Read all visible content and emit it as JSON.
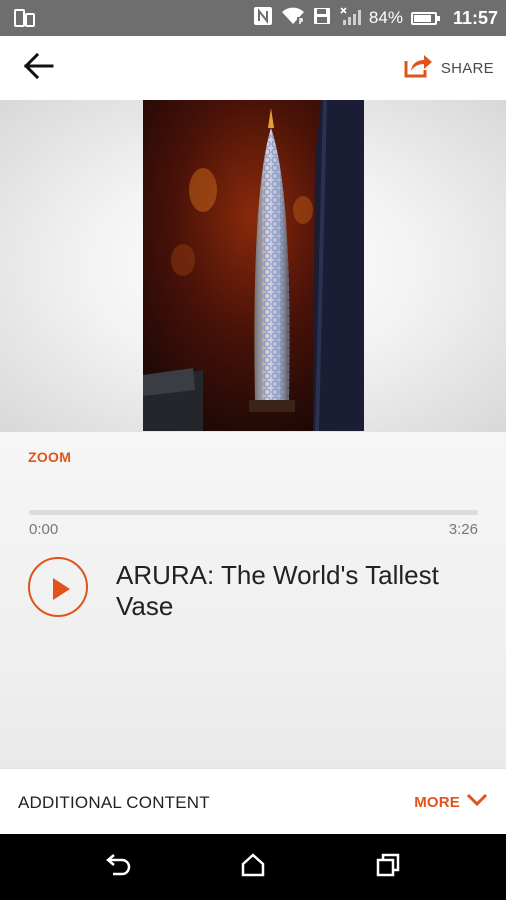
{
  "status_bar": {
    "battery_percent": "84%",
    "battery_level": 0.84,
    "time": "11:57",
    "icons": [
      "screen-mirror-icon",
      "nfc-icon",
      "wifi-icon",
      "save-icon",
      "signal-icon",
      "battery-icon"
    ]
  },
  "app_bar": {
    "share_label": "SHARE",
    "icons": [
      "back-arrow-icon",
      "share-icon"
    ]
  },
  "content": {
    "zoom_label": "ZOOM",
    "time_elapsed": "0:00",
    "time_total": "3:26",
    "progress": 0,
    "track_title": "ARURA: The World's Tallest Vase"
  },
  "additional": {
    "label": "ADDITIONAL CONTENT",
    "more_label": "MORE"
  },
  "colors": {
    "accent": "#e0541c",
    "status_bar": "#6e6e6e"
  },
  "nav_bar": {
    "icons": [
      "back-icon",
      "home-icon",
      "recents-icon"
    ]
  }
}
